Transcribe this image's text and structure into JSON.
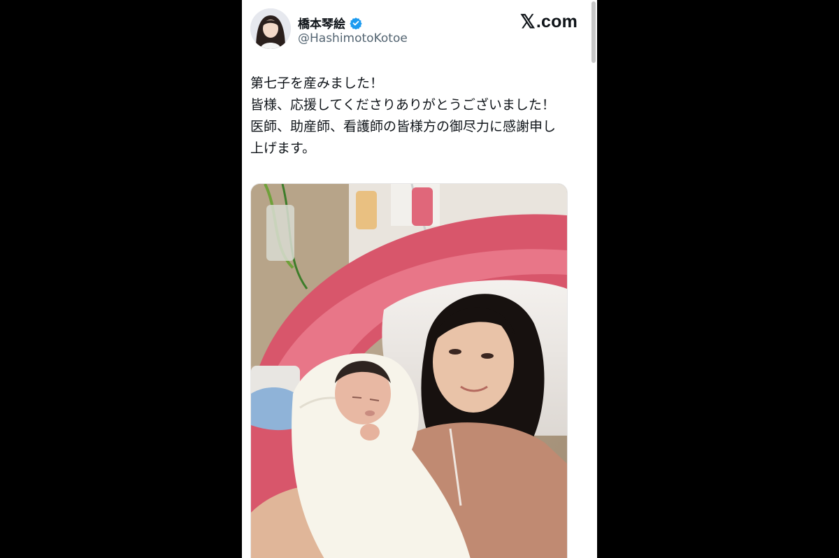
{
  "post": {
    "author": {
      "display_name": "橋本琴絵",
      "handle": "@HashimotoKotoe",
      "verified": true,
      "verified_icon": "verified-badge-icon",
      "avatar_icon": "profile-avatar"
    },
    "brand": {
      "x_glyph": "𝕏",
      "suffix": ".com"
    },
    "text_lines": [
      "第七子を産みました！",
      "皆様、応援してくださりありがとうございました！",
      "医師、助産師、看護師の皆様方の御尽力に感謝申し",
      "上げます。"
    ],
    "media": {
      "kind": "photo",
      "icon": "photo-mother-with-newborn"
    }
  },
  "colors": {
    "page_background": "#000000",
    "card_background": "#ffffff",
    "text_primary": "#0f1419",
    "text_secondary": "#536471",
    "verified_blue": "#1d9bf0"
  }
}
